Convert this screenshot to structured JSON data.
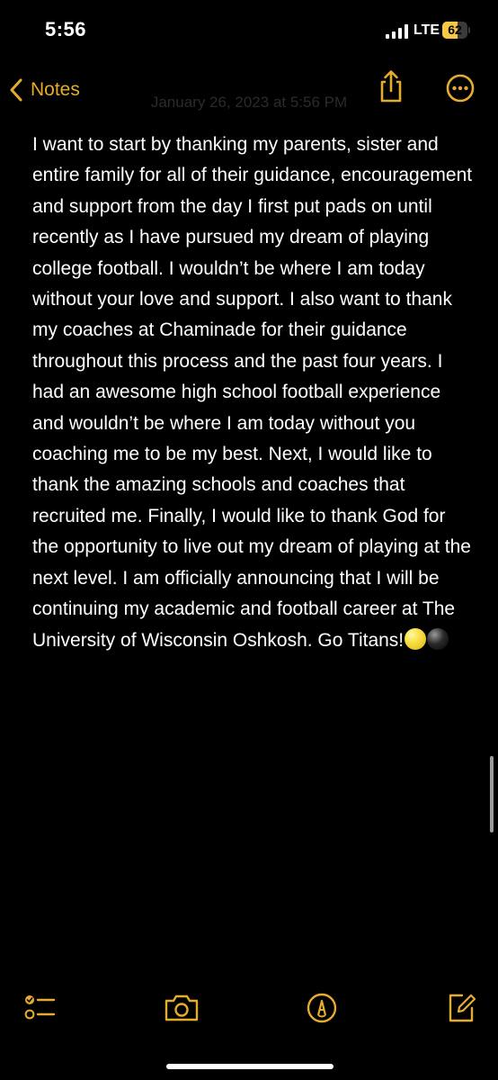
{
  "status_bar": {
    "time": "5:56",
    "network": "LTE",
    "battery_level": "62",
    "battery_percent": 62,
    "icons": [
      "signal-bars-icon",
      "battery-icon"
    ]
  },
  "nav": {
    "back_label": "Notes",
    "back_icon": "chevron-left-icon",
    "share_icon": "share-icon",
    "more_icon": "ellipsis-circle-icon"
  },
  "note": {
    "date": "January 26, 2023 at 5:56 PM",
    "body": "I want to start by thanking my parents, sister and entire family for all of their guidance, encouragement and support from the day I first put pads on until recently as I have pursued my dream of playing college football.  I wouldn’t be where I am today without your love and support.  I also want to thank my coaches at Chaminade for their guidance throughout this process and the past four years.  I had an awesome high school football experience and wouldn’t be where I am today without you coaching me to be my best.  Next, I would like to thank the amazing schools and coaches that recruited me. Finally, I would like to thank God for the opportunity to live out my dream of playing at the next level.  I am officially announcing that I will be continuing my academic and football career at The University of Wisconsin Oshkosh.  Go Titans!",
    "emojis": [
      "yellow-circle",
      "black-circle"
    ]
  },
  "toolbar": {
    "items": [
      "checklist-icon",
      "camera-icon",
      "markup-pen-icon",
      "compose-icon"
    ]
  },
  "colors": {
    "accent": "#e6ac2b",
    "background": "#000000",
    "text": "#ffffff",
    "battery_fill": "#f7c843"
  }
}
